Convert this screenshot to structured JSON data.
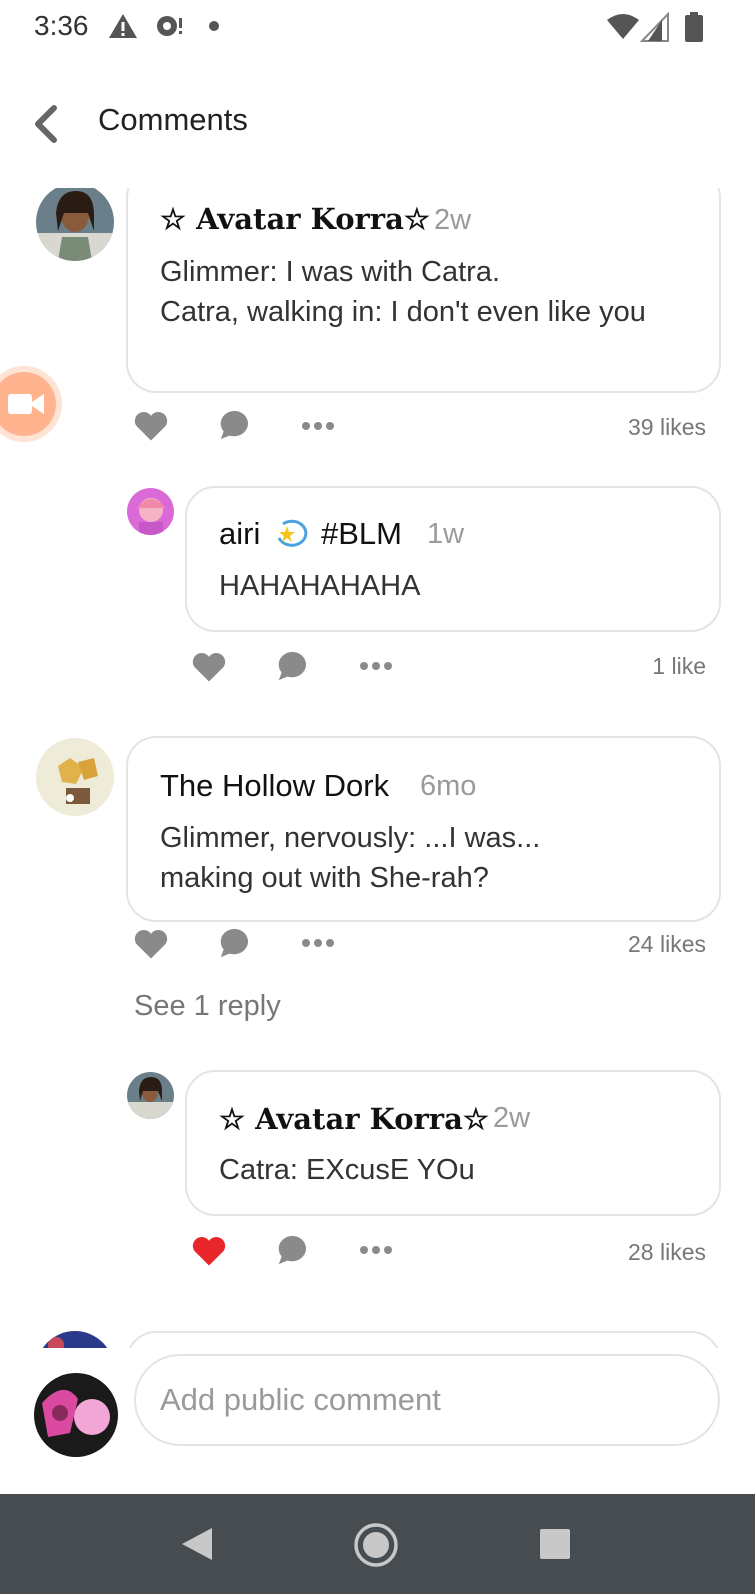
{
  "status": {
    "time": "3:36"
  },
  "header": {
    "title": "Comments"
  },
  "comments": [
    {
      "name": "☆ Avatar Korra☆",
      "time": "2w",
      "text": "Glimmer: I was with Catra.\nCatra, walking in: I don't even like you",
      "likes": "39 likes"
    },
    {
      "name": "airi",
      "badge": "#BLM",
      "time": "1w",
      "text": "HAHAHAHAHA",
      "likes": "1 like"
    },
    {
      "name": "The Hollow Dork",
      "time": "6mo",
      "text": "Glimmer, nervously: ...I was... making out with She-rah?",
      "likes": "24 likes",
      "see_replies": "See 1 reply"
    },
    {
      "name": "☆ Avatar Korra☆",
      "time": "2w",
      "text": "Catra: EXcusE YOu",
      "likes": "28 likes",
      "liked": true
    }
  ],
  "composer": {
    "placeholder": "Add public comment"
  },
  "colors": {
    "liked_heart": "#e8262b",
    "icon_gray": "#8a8a8a",
    "navbar": "#474c51"
  }
}
